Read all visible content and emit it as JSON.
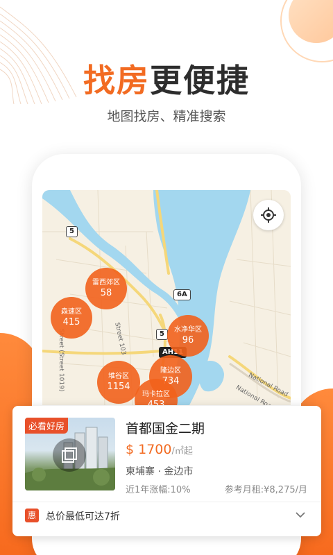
{
  "headline": {
    "part1": "找房",
    "part2": "更便捷"
  },
  "subheadline": "地图找房、精准搜索",
  "map": {
    "road_shields": [
      "5",
      "6A",
      "5",
      "AH11"
    ],
    "street_labels": [
      "Street 103",
      "Street (Street 1019)",
      "National Road",
      "National Road",
      "ey Sa",
      "Sen B"
    ],
    "clusters": [
      {
        "name": "雷西郊区",
        "count": "58"
      },
      {
        "name": "森速区",
        "count": "415"
      },
      {
        "name": "水净华区",
        "count": "96"
      },
      {
        "name": "堆谷区",
        "count": "1154"
      },
      {
        "name": "隆边区",
        "count": "734"
      },
      {
        "name": "玛卡拉区",
        "count": "453"
      }
    ]
  },
  "listing": {
    "badge": "必看好房",
    "title": "首都国金二期",
    "price_value": "$ 1700",
    "price_unit": "/㎡起",
    "location": "柬埔寨 · 金边市",
    "stat_left": "近1年涨幅:10%",
    "stat_right": "参考月租:¥8,275/月",
    "promo_icon": "惠",
    "promo_text": "总价最低可达7折"
  },
  "colors": {
    "accent": "#f26b22",
    "cluster": "#f2621c",
    "water": "#a3d7ef"
  }
}
